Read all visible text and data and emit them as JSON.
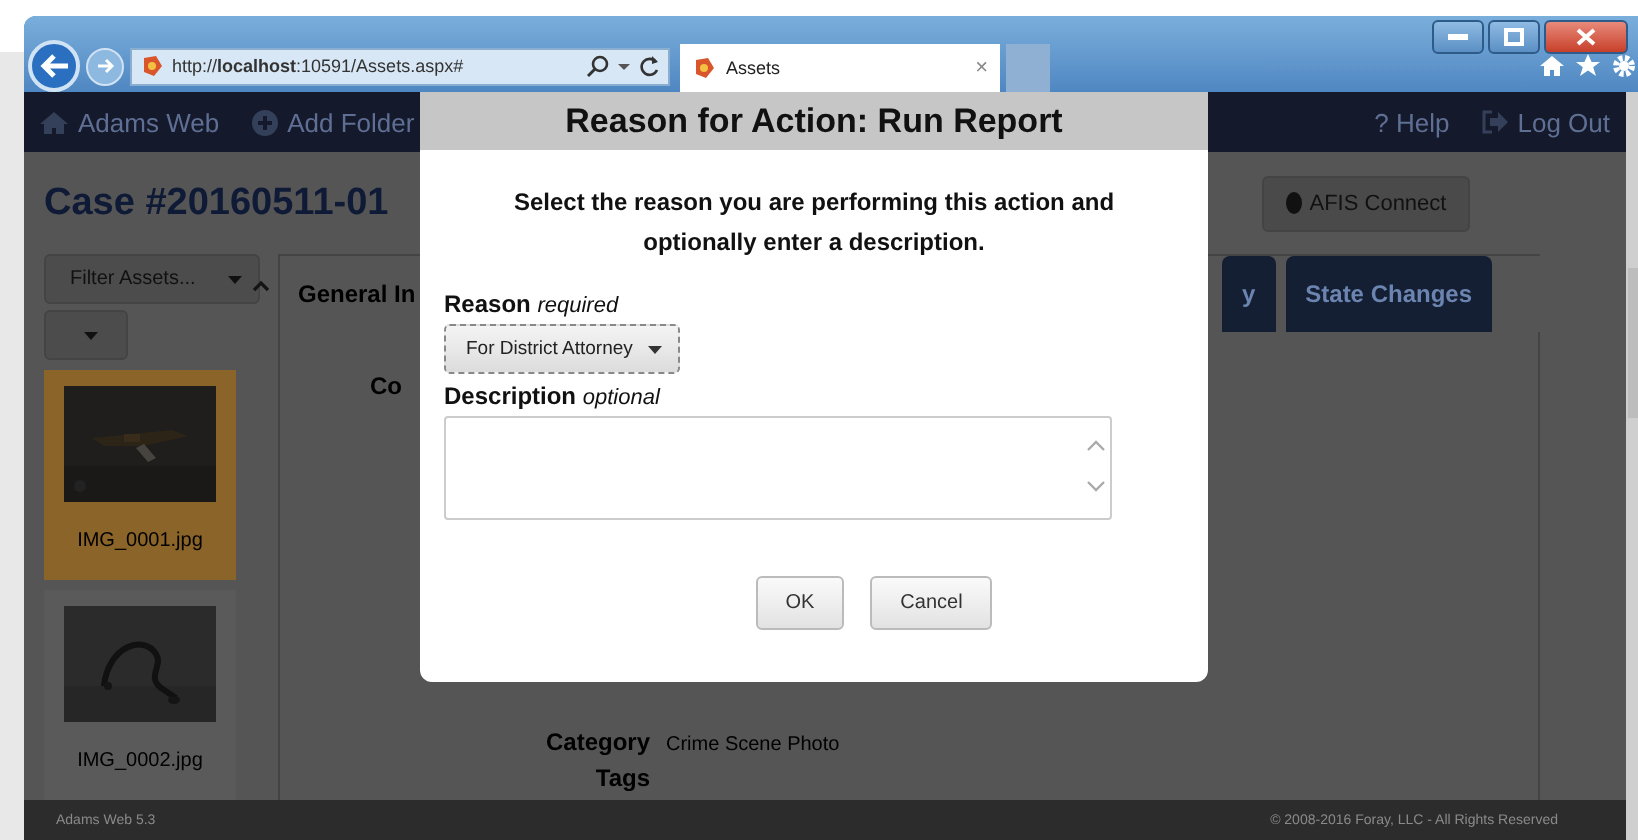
{
  "browser": {
    "address": "http://**localhost**:10591/Assets.aspx#",
    "tab": {
      "title": "Assets",
      "close": "×"
    }
  },
  "navbar": {
    "brand": "Adams Web",
    "add": "Add Folder",
    "help": "? Help",
    "logout": "Log Out"
  },
  "case_title": "Case #20160511-01",
  "toolbar_button": "AFIS Connect",
  "filter": "Filter Assets...",
  "assets": [
    {
      "name": "IMG_0001.jpg",
      "selected": true,
      "kind": "picture"
    },
    {
      "name": "IMG_0002.jpg",
      "selected": false,
      "kind": "picture"
    }
  ],
  "details": {
    "heading": "General In",
    "partial_label": "Co",
    "fields": [
      {
        "label": "Category",
        "value": "Crime Scene Photo"
      },
      {
        "label": "Tags"
      }
    ]
  },
  "tabs": [
    {
      "label": "y"
    },
    {
      "label": "State Changes"
    }
  ],
  "footer": {
    "version": "Adams Web 5.3",
    "copyright": "© 2008-2016 Foray, LLC - All Rights Reserved"
  },
  "dialog": {
    "title": "Reason for Action: Run Report",
    "message": "Select the reason you are performing this action and optionally enter a description.",
    "reason": {
      "label": "Reason",
      "hint": "required",
      "value": "For District Attorney"
    },
    "description": {
      "label": "Description",
      "hint": "optional"
    },
    "buttons": [
      "OK",
      "Cancel"
    ]
  }
}
